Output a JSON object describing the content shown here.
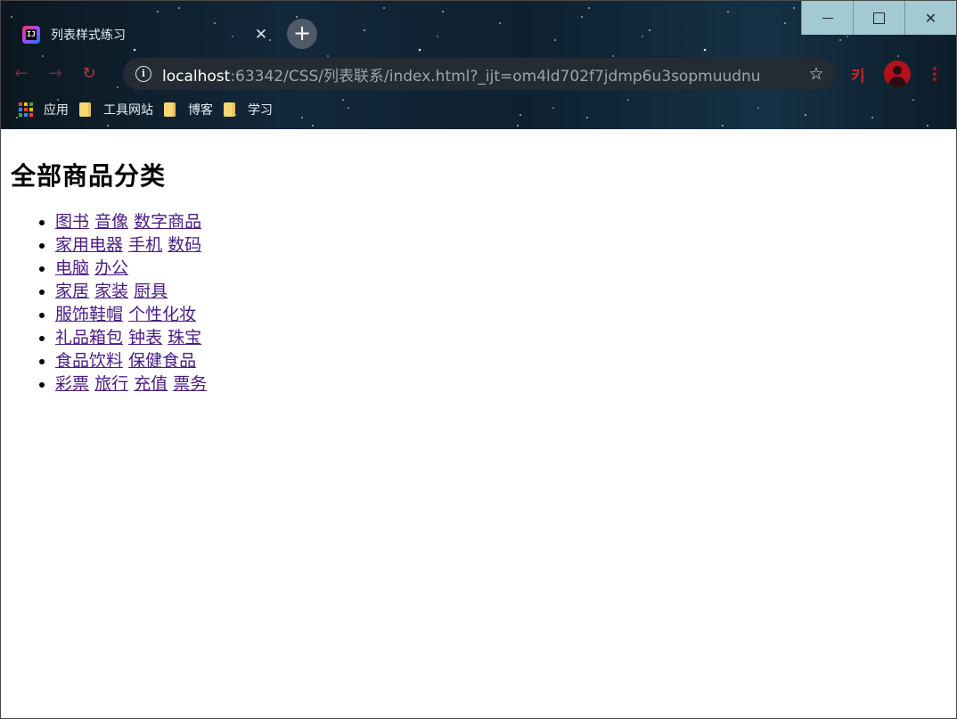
{
  "browser": {
    "tab": {
      "title": "列表样式练习",
      "close_glyph": "✕"
    },
    "new_tab_glyph": "+",
    "window_controls": {
      "close_glyph": "✕"
    },
    "nav": {
      "back_glyph": "←",
      "forward_glyph": "→",
      "reload_glyph": "↻"
    },
    "address_bar": {
      "host": "localhost",
      "rest": ":63342/CSS/列表联系/index.html?_ijt=om4ld702f7jdmp6u3sopmuudnu"
    },
    "star_glyph": "☆",
    "extension_glyph": "키",
    "menu_glyph": "⋮",
    "bookmarks": [
      {
        "label": "应用",
        "icon": "apps-icon"
      },
      {
        "label": "工具网站",
        "icon": "folder-icon"
      },
      {
        "label": "博客",
        "icon": "folder-icon"
      },
      {
        "label": "学习",
        "icon": "folder-icon"
      }
    ],
    "apps_icon_colors": [
      "#ea4335",
      "#fbbc04",
      "#34a853",
      "#4285f4",
      "#ea4335",
      "#fbbc04",
      "#34a853",
      "#4285f4",
      "#ea4335"
    ]
  },
  "page": {
    "heading": "全部商品分类",
    "categories": [
      [
        "图书",
        "音像",
        "数字商品"
      ],
      [
        "家用电器",
        "手机",
        "数码"
      ],
      [
        "电脑",
        "办公"
      ],
      [
        "家居",
        "家装",
        "厨具"
      ],
      [
        "服饰鞋帽",
        "个性化妆"
      ],
      [
        "礼品箱包",
        "钟表",
        "珠宝"
      ],
      [
        "食品饮料",
        "保健食品"
      ],
      [
        "彩票",
        "旅行",
        "充值",
        "票务"
      ]
    ],
    "link_color": "#4a1a86"
  }
}
